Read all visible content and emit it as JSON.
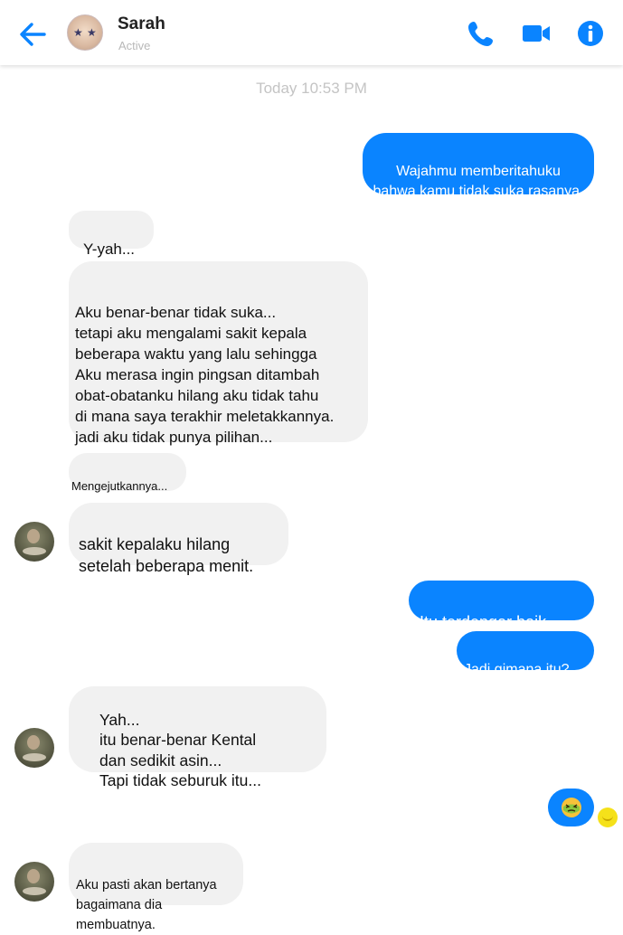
{
  "header": {
    "name": "Sarah",
    "status": "Active",
    "icons": {
      "back": "back-arrow-icon",
      "call": "phone-icon",
      "video": "video-camera-icon",
      "info": "info-icon"
    },
    "accent": "#0a84ff"
  },
  "timestamp": "Today 10:53 PM",
  "messages": {
    "m1": "Wajahmu memberitahuku\nbahwa kamu tidak suka rasanya.",
    "m2": "Y-yah...",
    "m3": "Aku benar-benar tidak suka...\ntetapi aku mengalami sakit kepala\nbeberapa waktu yang lalu sehingga\nAku merasa ingin pingsan ditambah\nobat-obatanku hilang aku tidak tahu\ndi mana saya terakhir meletakkannya.\njadi aku tidak punya pilihan...",
    "m4": "Mengejutkannya...",
    "m5": "sakit kepalaku hilang\nsetelah beberapa menit.",
    "m6": "Itu terdengar baik...",
    "m7": "Jadi gimana itu?",
    "m8": "Yah...\nitu benar-benar Kental\ndan sedikit asin...\nTapi tidak seburuk itu...",
    "m9_emoji": "nauseated-face-emoji",
    "m10": "Aku pasti akan bertanya\nbagaimana dia membuatnya."
  },
  "colors": {
    "outgoing": "#0a84ff",
    "incoming": "#f1f1f1",
    "timestamp": "#c4c4c4",
    "seen": "#f5e11a"
  }
}
